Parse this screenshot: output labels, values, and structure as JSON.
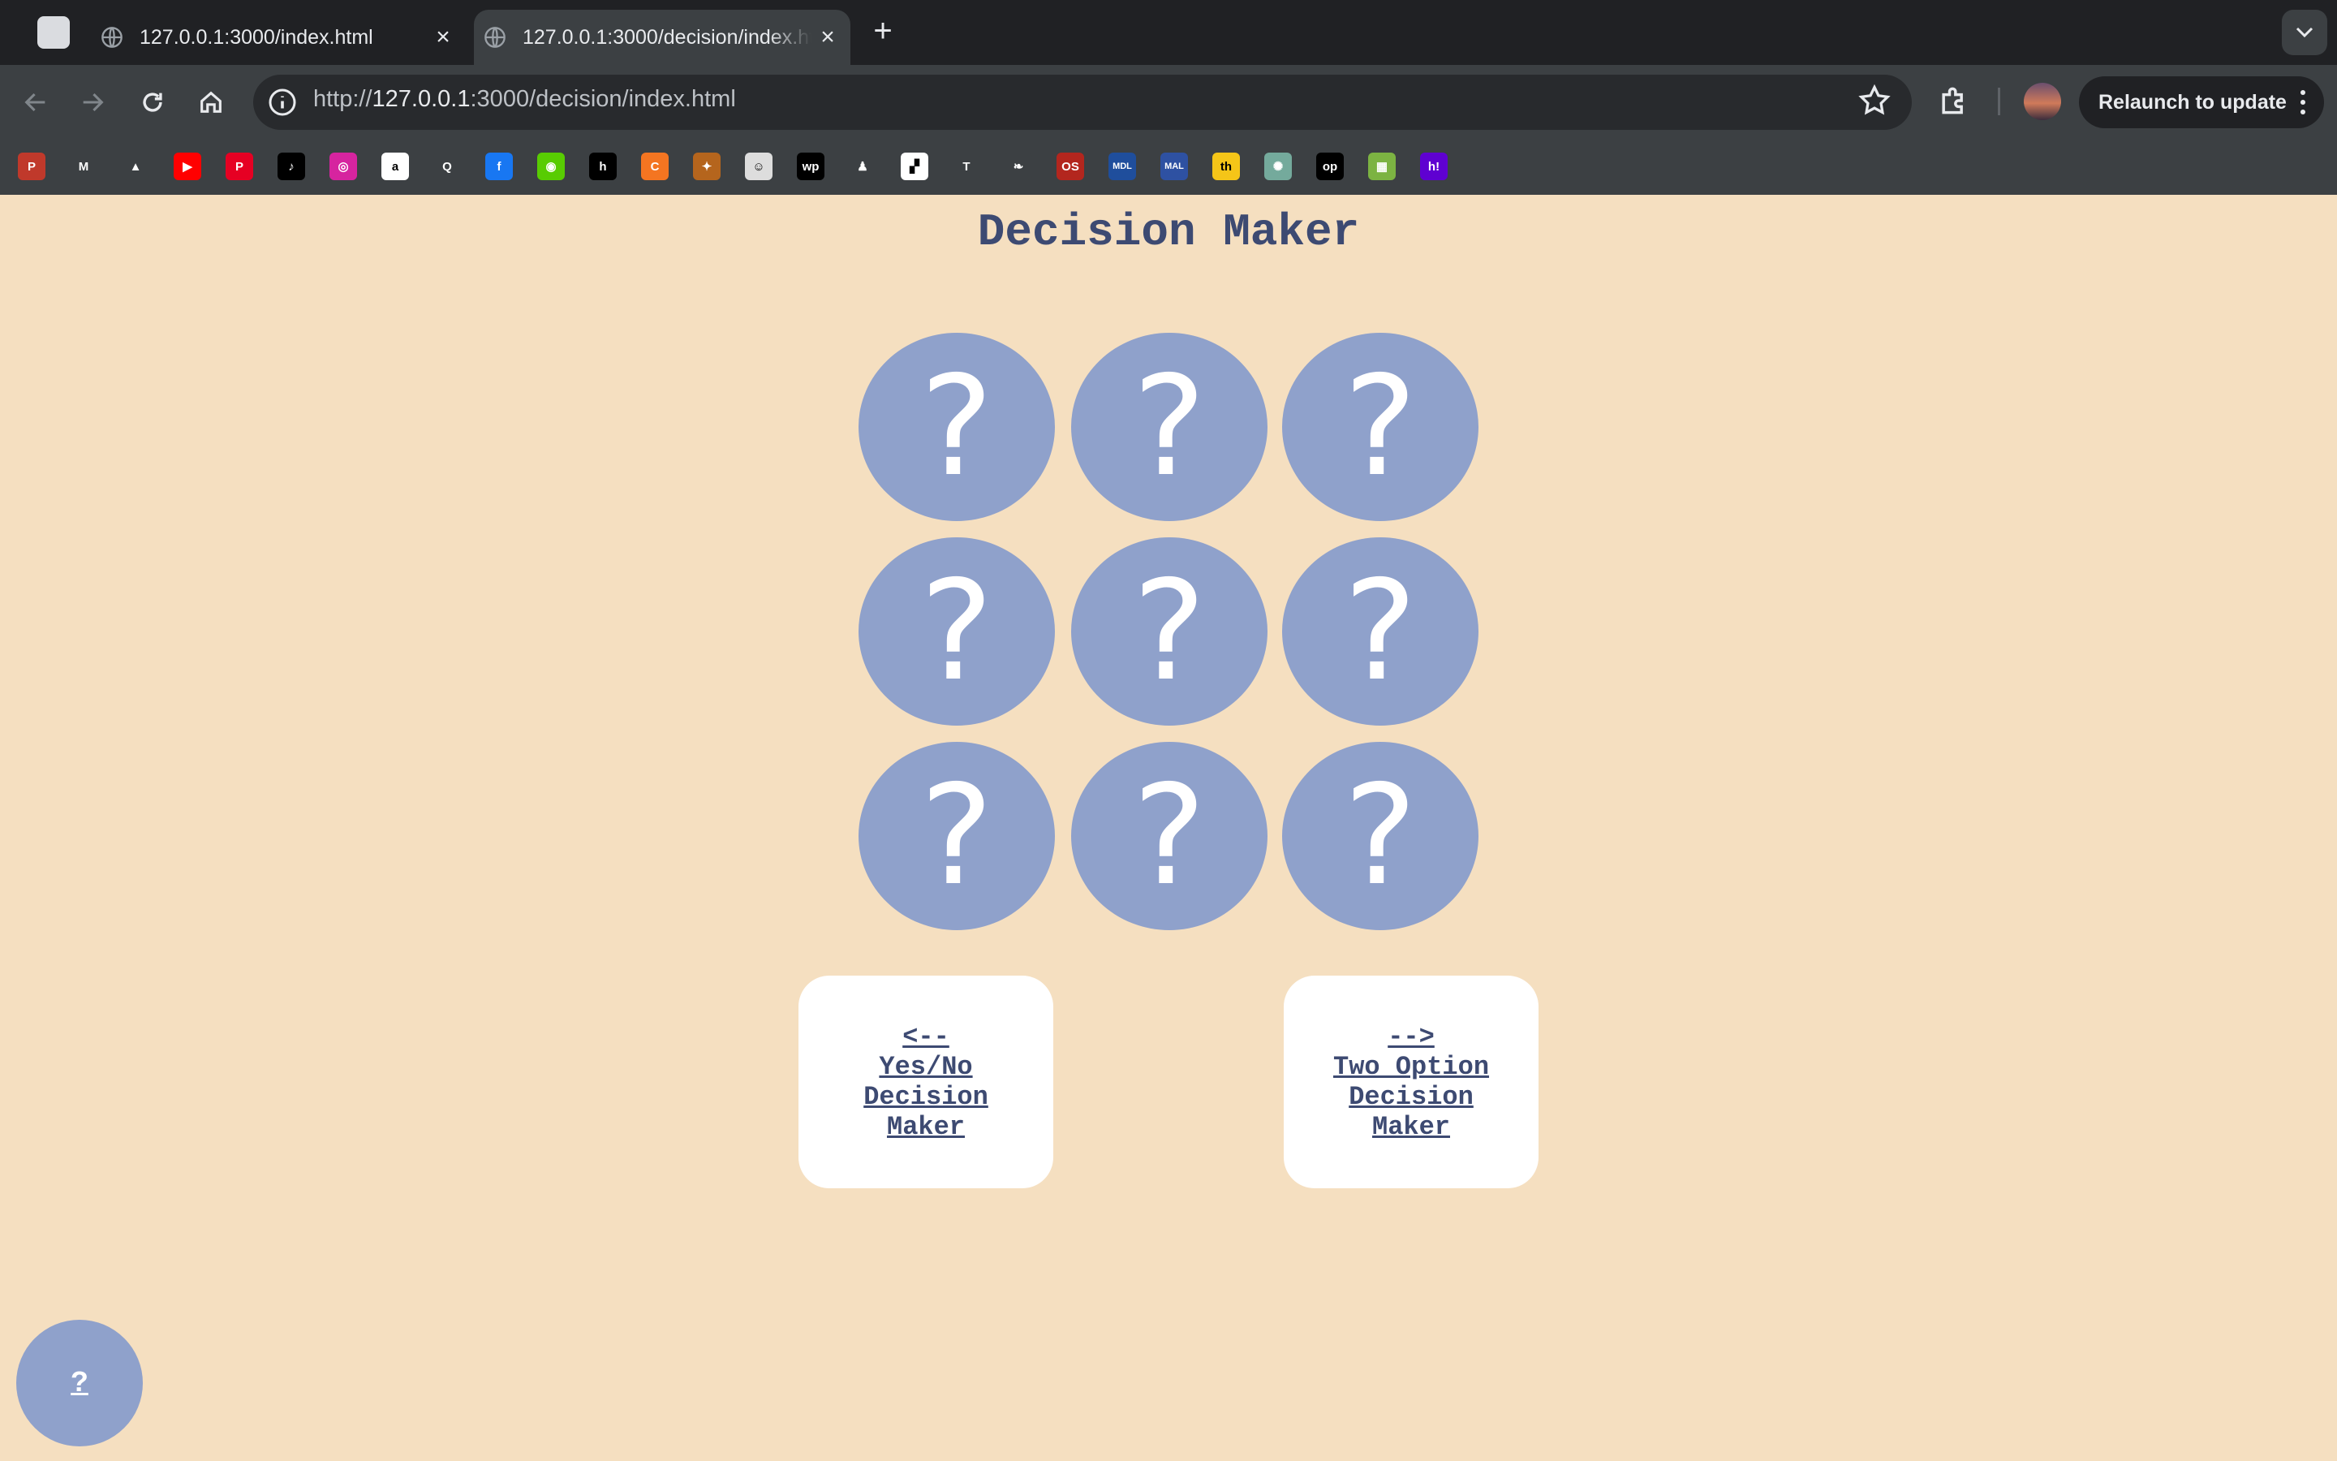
{
  "browser": {
    "tabs": [
      {
        "title": "127.0.0.1:3000/index.html",
        "active": false
      },
      {
        "title": "127.0.0.1:3000/decision/index.html",
        "active": true
      }
    ],
    "url_prefix": "http://",
    "url_host": "127.0.0.1",
    "url_rest": ":3000/decision/index.html",
    "relaunch_label": "Relaunch to update",
    "bookmarks": [
      {
        "name": "pocketcasts",
        "glyph": "P",
        "bg": "#c0392b"
      },
      {
        "name": "gmail",
        "glyph": "M",
        "bg": "#3c4043"
      },
      {
        "name": "google-drive",
        "glyph": "▲",
        "bg": "#3c4043"
      },
      {
        "name": "youtube",
        "glyph": "▶",
        "bg": "#ff0000"
      },
      {
        "name": "pinterest",
        "glyph": "P",
        "bg": "#e60023"
      },
      {
        "name": "tiktok",
        "glyph": "♪",
        "bg": "#000000"
      },
      {
        "name": "instagram",
        "glyph": "◎",
        "bg": "#d6249f"
      },
      {
        "name": "amazon",
        "glyph": "a",
        "bg": "#ffffff"
      },
      {
        "name": "quora",
        "glyph": "Q",
        "bg": "#3c4043"
      },
      {
        "name": "facebook",
        "glyph": "f",
        "bg": "#1877f2"
      },
      {
        "name": "duolingo",
        "glyph": "◉",
        "bg": "#58cc02"
      },
      {
        "name": "hulu",
        "glyph": "h",
        "bg": "#000000"
      },
      {
        "name": "crunchyroll",
        "glyph": "C",
        "bg": "#f47521"
      },
      {
        "name": "bird-app",
        "glyph": "✦",
        "bg": "#b5651d"
      },
      {
        "name": "robot-app",
        "glyph": "☺",
        "bg": "#dddddd"
      },
      {
        "name": "washington-post",
        "glyph": "wp",
        "bg": "#000000"
      },
      {
        "name": "figure-app",
        "glyph": "♟",
        "bg": "#3c4043"
      },
      {
        "name": "grid-app",
        "glyph": "▞",
        "bg": "#ffffff"
      },
      {
        "name": "nytimes",
        "glyph": "T",
        "bg": "#3c4043"
      },
      {
        "name": "leaf-app",
        "glyph": "❧",
        "bg": "#3c4043"
      },
      {
        "name": "os-app",
        "glyph": "OS",
        "bg": "#b3261e"
      },
      {
        "name": "mydramalist",
        "glyph": "MDL",
        "bg": "#1f4e9c"
      },
      {
        "name": "myanimelist",
        "glyph": "MAL",
        "bg": "#2e51a2"
      },
      {
        "name": "imdb-style",
        "glyph": "th",
        "bg": "#f5c518"
      },
      {
        "name": "chatgpt",
        "glyph": "✺",
        "bg": "#74aa9c"
      },
      {
        "name": "op-app",
        "glyph": "op",
        "bg": "#000000"
      },
      {
        "name": "maps-app",
        "glyph": "▦",
        "bg": "#7cb342"
      },
      {
        "name": "yahoo",
        "glyph": "h!",
        "bg": "#5f01d1"
      }
    ]
  },
  "page": {
    "title": "Decision Maker",
    "cells": [
      "?",
      "?",
      "?",
      "?",
      "?",
      "?",
      "?",
      "?",
      "?"
    ],
    "prev_card": {
      "arrow": "<--",
      "lines": [
        "Yes/No",
        "Decision",
        "Maker"
      ]
    },
    "next_card": {
      "arrow": "-->",
      "lines": [
        "Two Option",
        "Decision",
        "Maker"
      ]
    },
    "help_label": "?"
  },
  "colors": {
    "page_bg": "#f5dfc0",
    "accent": "#8fa1cb",
    "text": "#3d4a72"
  }
}
